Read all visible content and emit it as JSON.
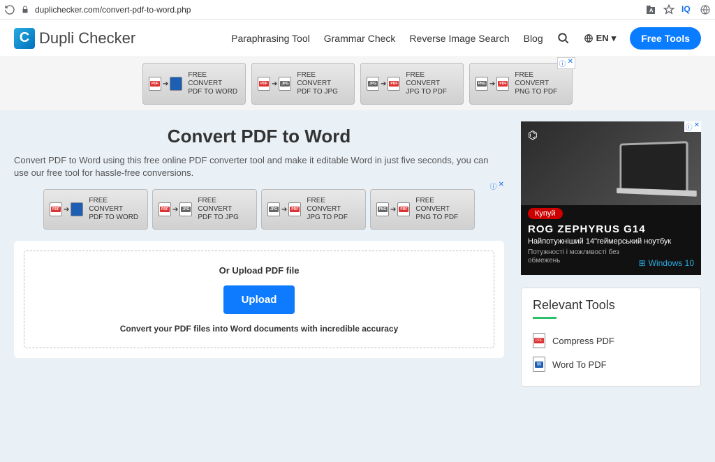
{
  "browser": {
    "url": "duplichecker.com/convert-pdf-to-word.php",
    "iq_label": "IQ"
  },
  "header": {
    "logo_text": "Dupli Checker",
    "nav": {
      "paraphrasing": "Paraphrasing Tool",
      "grammar": "Grammar Check",
      "reverse": "Reverse Image Search",
      "blog": "Blog"
    },
    "lang": "EN",
    "free_tools": "Free Tools"
  },
  "ad_buttons": [
    {
      "line1": "FREE CONVERT",
      "line2": "PDF TO WORD"
    },
    {
      "line1": "FREE CONVERT",
      "line2": "PDF TO JPG"
    },
    {
      "line1": "FREE CONVERT",
      "line2": "JPG TO PDF"
    },
    {
      "line1": "FREE CONVERT",
      "line2": "PNG TO PDF"
    }
  ],
  "page": {
    "title": "Convert PDF to Word",
    "description": "Convert PDF to Word using this free online PDF converter tool and make it editable Word in just five seconds, you can use our free tool for hassle-free conversions.",
    "upload_title": "Or Upload PDF file",
    "upload_button": "Upload",
    "upload_sub": "Convert your PDF files into Word documents with incredible accuracy"
  },
  "sidebar_ad": {
    "cta": "Купуй",
    "title": "ROG ZEPHYRUS G14",
    "sub": "Найпотужніший 14\"геймерський ноутбук",
    "small": "Потужності і можливості без обмежень",
    "win": "Windows 10"
  },
  "tools": {
    "heading": "Relevant Tools",
    "items": {
      "compress": "Compress PDF",
      "wordtopdf": "Word To PDF"
    }
  }
}
